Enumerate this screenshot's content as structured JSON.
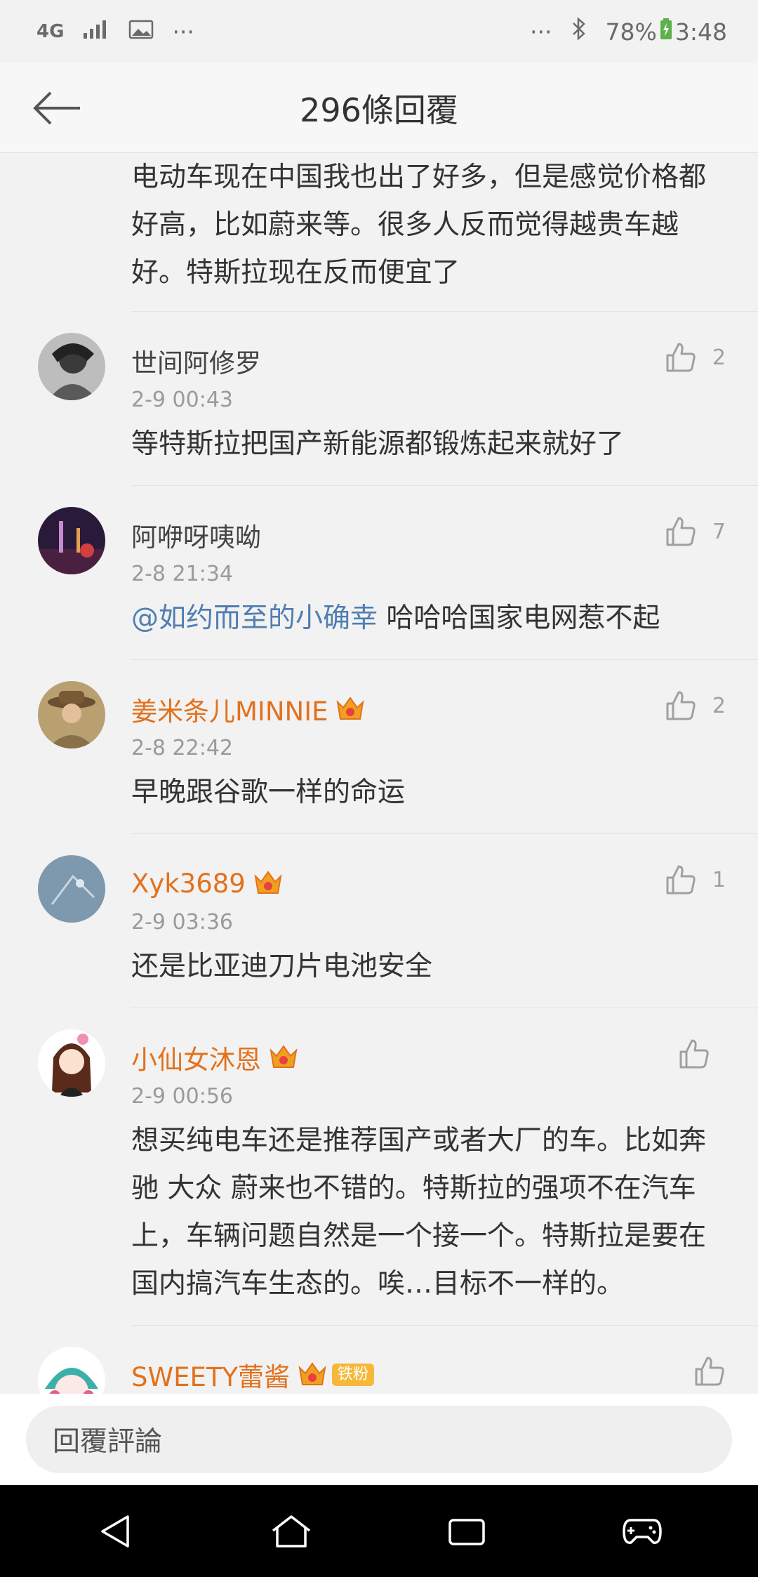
{
  "status": {
    "network": "4G",
    "dots_left": "···",
    "dots_right": "···",
    "battery": "78%",
    "time": "3:48"
  },
  "header": {
    "title": "296條回覆"
  },
  "lead_text": "电动车现在中国我也出了好多，但是感觉价格都好高，比如蔚来等。很多人反而觉得越贵车越好。特斯拉现在反而便宜了",
  "comments": [
    {
      "name": "世间阿修罗",
      "vip": false,
      "time": "2-9 00:43",
      "likes": "2",
      "text": "等特斯拉把国产新能源都锻炼起来就好了"
    },
    {
      "name": "阿咿呀咦呦",
      "vip": false,
      "time": "2-8 21:34",
      "likes": "7",
      "mention": "@如约而至的小确幸",
      "text": " 哈哈哈国家电网惹不起"
    },
    {
      "name": "姜米条儿MINNIE",
      "vip": true,
      "time": "2-8 22:42",
      "likes": "2",
      "text": "早晚跟谷歌一样的命运"
    },
    {
      "name": "Xyk3689",
      "vip": true,
      "time": "2-9 03:36",
      "likes": "1",
      "text": "还是比亚迪刀片电池安全"
    },
    {
      "name": "小仙女沐恩",
      "vip": true,
      "time": "2-9 00:56",
      "likes": "",
      "text": "想买纯电车还是推荐国产或者大厂的车。比如奔驰 大众 蔚来也不错的。特斯拉的强项不在汽车上，车辆问题自然是一个接一个。特斯拉是要在国内搞汽车生态的。唉…目标不一样的。"
    },
    {
      "name": "SWEETY蕾酱",
      "vip": true,
      "badge": "铁粉",
      "time": "",
      "likes": "",
      "text": ""
    }
  ],
  "reply_placeholder": "回覆評論",
  "colors": {
    "vip_name": "#e2711d",
    "mention": "#4f7eb2",
    "background": "#f2f2f2"
  }
}
